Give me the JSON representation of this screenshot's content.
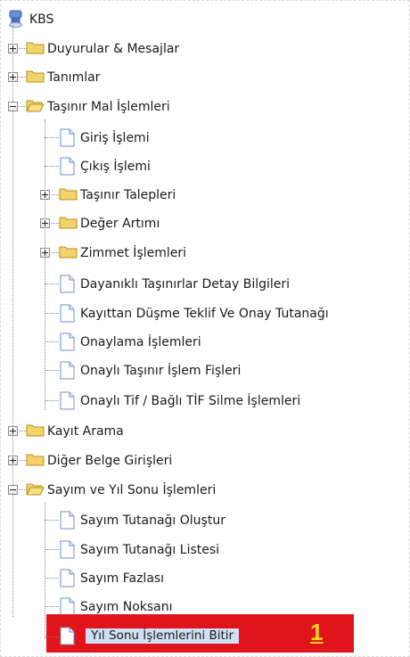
{
  "root": {
    "label": "KBS",
    "icon": "kbs-root-icon"
  },
  "items": [
    {
      "label": "Duyurular & Mesajlar",
      "type": "folder",
      "expanded": false
    },
    {
      "label": "Tanımlar",
      "type": "folder",
      "expanded": false
    },
    {
      "label": "Taşınır Mal İşlemleri",
      "type": "folder",
      "expanded": true
    },
    {
      "label": "Giriş İşlemi",
      "type": "page"
    },
    {
      "label": "Çıkış İşlemi",
      "type": "page"
    },
    {
      "label": "Taşınır Talepleri",
      "type": "folder",
      "expanded": false
    },
    {
      "label": "Değer Artımı",
      "type": "folder",
      "expanded": false
    },
    {
      "label": "Zimmet İşlemleri",
      "type": "folder",
      "expanded": false
    },
    {
      "label": "Dayanıklı Taşınırlar Detay Bilgileri",
      "type": "page"
    },
    {
      "label": "Kayıttan Düşme Teklif Ve Onay Tutanağı",
      "type": "page"
    },
    {
      "label": "Onaylama İşlemleri",
      "type": "page"
    },
    {
      "label": "Onaylı Taşınır İşlem Fişleri",
      "type": "page"
    },
    {
      "label": "Onaylı Tif / Bağlı TİF Silme İşlemleri",
      "type": "page"
    },
    {
      "label": "Kayıt Arama",
      "type": "folder",
      "expanded": false
    },
    {
      "label": "Diğer Belge Girişleri",
      "type": "folder",
      "expanded": false
    },
    {
      "label": "Sayım ve Yıl Sonu İşlemleri",
      "type": "folder",
      "expanded": true
    },
    {
      "label": "Sayım Tutanağı Oluştur",
      "type": "page"
    },
    {
      "label": "Sayım Tutanağı Listesi",
      "type": "page"
    },
    {
      "label": "Sayım Fazlası",
      "type": "page"
    },
    {
      "label": "Sayım Noksanı",
      "type": "page"
    },
    {
      "label": "Yıl Sonu İşlemlerini Bitir",
      "type": "page",
      "selected": true
    }
  ],
  "highlight": {
    "step_number": "1",
    "color": "#e1141b",
    "number_color": "#ffd21a"
  },
  "colors": {
    "folder": "#f3d36b",
    "selection": "#cfe0f4"
  }
}
